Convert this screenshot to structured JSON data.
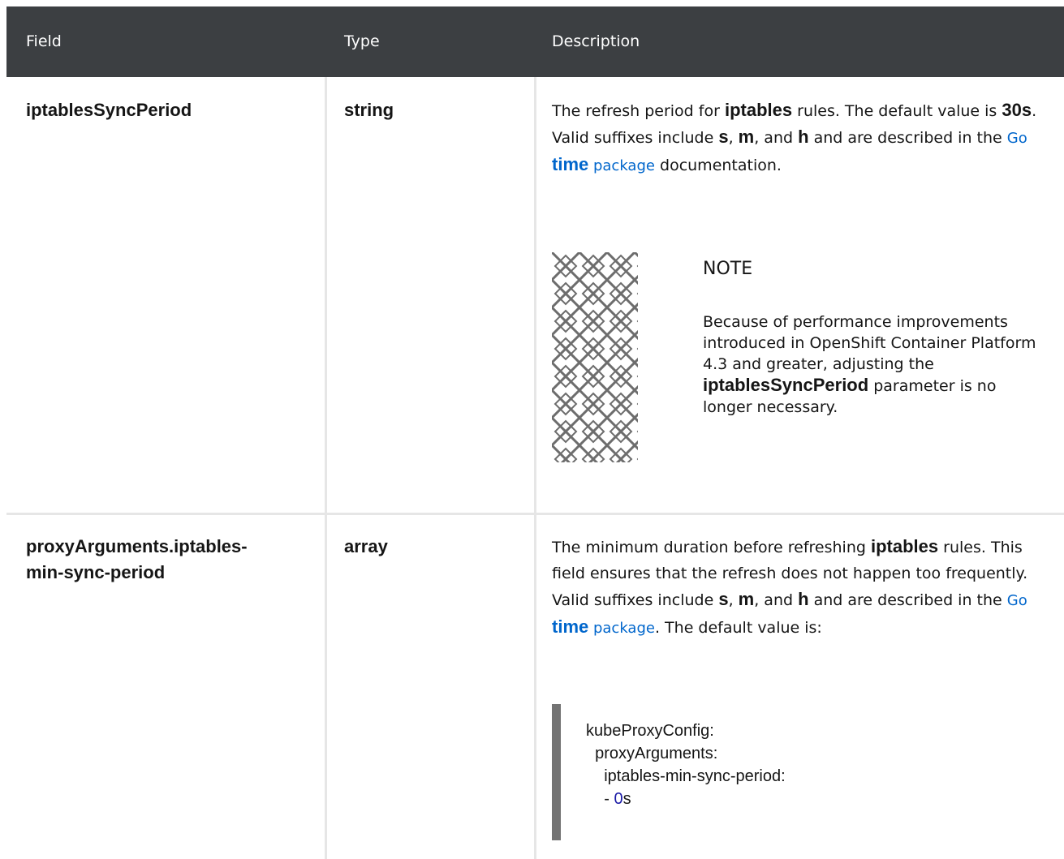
{
  "table": {
    "headers": {
      "field": "Field",
      "type": "Type",
      "description": "Description"
    },
    "rows": [
      {
        "field": "iptablesSyncPeriod",
        "type": "string",
        "desc": {
          "t1": "The refresh period for ",
          "b1": "iptables",
          "t2": " rules. The default value is ",
          "b2": "30s",
          "t3": ". Valid suffixes include ",
          "b3": "s",
          "t4": ", ",
          "b4": "m",
          "t5": ", and ",
          "b5": "h",
          "t6": " and are described in the ",
          "link_pre": "Go ",
          "link_bold": "time",
          "link_post": " package",
          "t7": " documentation."
        },
        "note": {
          "title": "NOTE",
          "t1": "Because of performance improvements introduced in OpenShift Container Platform 4.3 and greater, adjusting the ",
          "b1": "iptablesSyncPeriod",
          "t2": " parameter is no longer necessary."
        }
      },
      {
        "field_line1": "proxyArguments.iptables-",
        "field_line2": "min-sync-period",
        "type": "array",
        "desc": {
          "t1": "The minimum duration before refreshing ",
          "b1": "iptables",
          "t2": " rules. This field ensures that the refresh does not happen too frequently. Valid suffixes include ",
          "b2": "s",
          "t3": ", ",
          "b3": "m",
          "t4": ", and ",
          "b4": "h",
          "t5": " and are described in the ",
          "link_pre": "Go ",
          "link_bold": "time",
          "link_post": " package",
          "t6": ". The default value is:"
        },
        "code": {
          "line1": "kubeProxyConfig:",
          "line2": "  proxyArguments:",
          "line3": "    iptables-min-sync-period:",
          "line4_prefix": "    - ",
          "line4_num": "0",
          "line4_suffix": "s"
        }
      }
    ]
  }
}
